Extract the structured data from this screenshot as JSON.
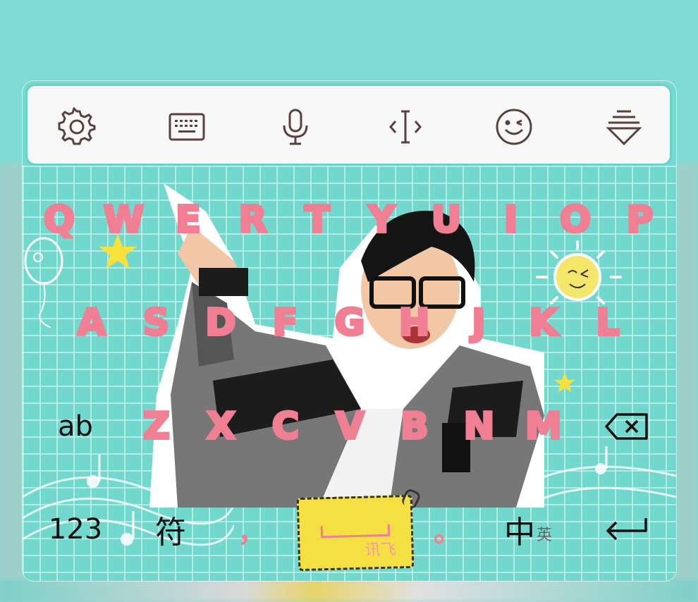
{
  "toolbar": {
    "icons": [
      "settings-icon",
      "keyboard-icon",
      "microphone-icon",
      "cursor-icon",
      "emoji-icon",
      "collapse-icon"
    ]
  },
  "keyboard": {
    "row1": [
      "Q",
      "W",
      "E",
      "R",
      "T",
      "Y",
      "U",
      "I",
      "O",
      "P"
    ],
    "row2": [
      "A",
      "S",
      "D",
      "F",
      "G",
      "H",
      "J",
      "K",
      "L"
    ],
    "row3_left": "ab",
    "row3": [
      "Z",
      "X",
      "C",
      "V",
      "B",
      "N",
      "M"
    ],
    "row4": {
      "numbers": "123",
      "symbols": "符",
      "comma": "，",
      "space_brand": "讯飞",
      "period": "。",
      "lang": "中",
      "lang_sub": "英"
    }
  },
  "colors": {
    "background": "#7fdcd4",
    "letters": "#f07f94",
    "toolbar": "#f8f8f8",
    "space_key": "#f5e043"
  }
}
